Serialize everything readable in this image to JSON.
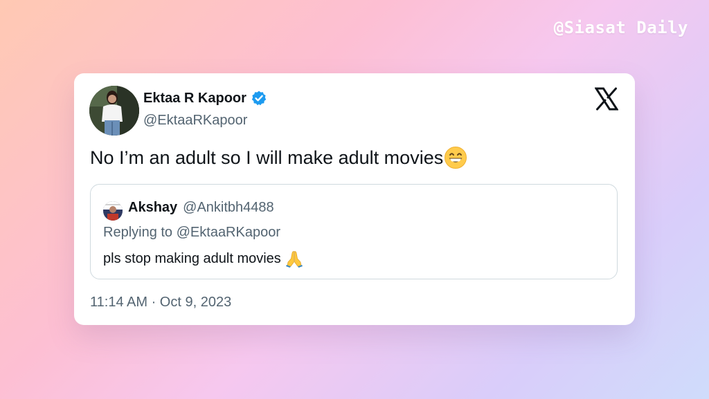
{
  "watermark": "@Siasat Daily",
  "tweet": {
    "author": {
      "name": "Ektaa R Kapoor",
      "handle": "@EktaaRKapoor",
      "verified": true,
      "verified_color": "#1d9bf0",
      "avatar_icon": "profile-photo"
    },
    "platform_icon": "x-logo-icon",
    "text": "No I’m an adult so I will make adult movies",
    "text_emoji": "grinning-face-with-smiling-eyes",
    "quoted": {
      "name": "Akshay",
      "handle": "@Ankitbh4488",
      "replying_to": "Replying to @EktaaRKapoor",
      "text": "pls stop making adult movies",
      "text_emoji": "folded-hands",
      "avatar_icon": "profile-photo"
    },
    "timestamp": "11:14 AM · Oct 9, 2023"
  },
  "colors": {
    "text_primary": "#0f1419",
    "text_secondary": "#536471",
    "border": "#cfd9de",
    "card_background": "#ffffff"
  }
}
